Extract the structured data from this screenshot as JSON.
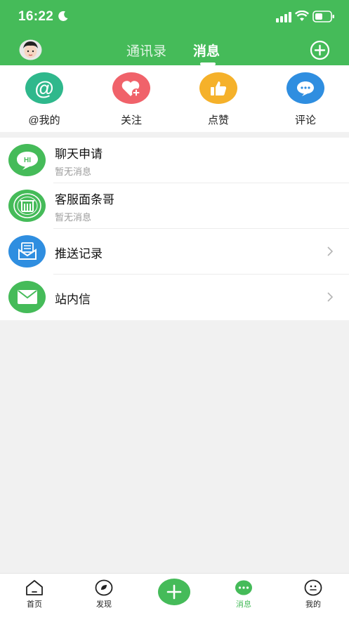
{
  "status_bar": {
    "time": "16:22"
  },
  "header": {
    "tabs": [
      {
        "label": "通讯录"
      },
      {
        "label": "消息"
      }
    ]
  },
  "quick_actions": [
    {
      "label": "@我的",
      "icon": "at-icon",
      "color": "#2fb88c"
    },
    {
      "label": "关注",
      "icon": "heart-plus-icon",
      "color": "#f0626a"
    },
    {
      "label": "点赞",
      "icon": "thumbs-up-icon",
      "color": "#f5b12a"
    },
    {
      "label": "评论",
      "icon": "chat-bubble-icon",
      "color": "#2f8ee0"
    }
  ],
  "messages": [
    {
      "title": "聊天申请",
      "subtitle": "暂无消息",
      "icon": "hi-bubble-icon",
      "icon_text": "HI",
      "color": "#45bb59"
    },
    {
      "title": "客服面条哥",
      "subtitle": "暂无消息",
      "icon": "service-logo-icon",
      "color": "#45bb59"
    },
    {
      "title": "推送记录",
      "icon": "push-inbox-icon",
      "color": "#2f8ee0"
    },
    {
      "title": "站内信",
      "icon": "envelope-icon",
      "color": "#45bb59"
    }
  ],
  "tabbar": {
    "items": [
      {
        "label": "首页",
        "icon": "home-icon"
      },
      {
        "label": "发现",
        "icon": "discover-icon"
      },
      {
        "label": "",
        "icon": "plus-icon"
      },
      {
        "label": "消息",
        "icon": "message-icon",
        "active": true
      },
      {
        "label": "我的",
        "icon": "profile-icon"
      }
    ]
  },
  "colors": {
    "brand_green": "#45bb59",
    "background": "#f1f1f1"
  }
}
